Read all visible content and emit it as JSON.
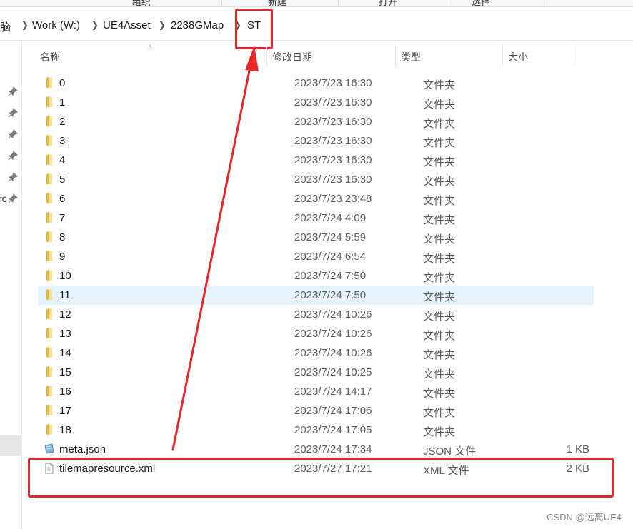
{
  "ribbon": {
    "labels": [
      "组织",
      "新建",
      "打开",
      "选择"
    ]
  },
  "breadcrumb": [
    {
      "label": "电脑"
    },
    {
      "label": "Work (W:)"
    },
    {
      "label": "UE4Asset"
    },
    {
      "label": "2238GMap"
    },
    {
      "label": "ST"
    }
  ],
  "left_pane": {
    "partial_text": "rc"
  },
  "columns": {
    "name": "名称",
    "date": "修改日期",
    "type": "类型",
    "size": "大小"
  },
  "files": [
    {
      "name": "0",
      "date": "2023/7/23 16:30",
      "type": "文件夹",
      "size": "",
      "icon": "folder-icon"
    },
    {
      "name": "1",
      "date": "2023/7/23 16:30",
      "type": "文件夹",
      "size": "",
      "icon": "folder-icon"
    },
    {
      "name": "2",
      "date": "2023/7/23 16:30",
      "type": "文件夹",
      "size": "",
      "icon": "folder-icon"
    },
    {
      "name": "3",
      "date": "2023/7/23 16:30",
      "type": "文件夹",
      "size": "",
      "icon": "folder-icon"
    },
    {
      "name": "4",
      "date": "2023/7/23 16:30",
      "type": "文件夹",
      "size": "",
      "icon": "folder-icon"
    },
    {
      "name": "5",
      "date": "2023/7/23 16:30",
      "type": "文件夹",
      "size": "",
      "icon": "folder-icon"
    },
    {
      "name": "6",
      "date": "2023/7/23 23:48",
      "type": "文件夹",
      "size": "",
      "icon": "folder-icon"
    },
    {
      "name": "7",
      "date": "2023/7/24 4:09",
      "type": "文件夹",
      "size": "",
      "icon": "folder-icon"
    },
    {
      "name": "8",
      "date": "2023/7/24 5:59",
      "type": "文件夹",
      "size": "",
      "icon": "folder-icon"
    },
    {
      "name": "9",
      "date": "2023/7/24 6:54",
      "type": "文件夹",
      "size": "",
      "icon": "folder-icon"
    },
    {
      "name": "10",
      "date": "2023/7/24 7:50",
      "type": "文件夹",
      "size": "",
      "icon": "folder-icon"
    },
    {
      "name": "11",
      "date": "2023/7/24 7:50",
      "type": "文件夹",
      "size": "",
      "icon": "folder-icon"
    },
    {
      "name": "12",
      "date": "2023/7/24 10:26",
      "type": "文件夹",
      "size": "",
      "icon": "folder-icon"
    },
    {
      "name": "13",
      "date": "2023/7/24 10:26",
      "type": "文件夹",
      "size": "",
      "icon": "folder-icon"
    },
    {
      "name": "14",
      "date": "2023/7/24 10:26",
      "type": "文件夹",
      "size": "",
      "icon": "folder-icon"
    },
    {
      "name": "15",
      "date": "2023/7/24 10:25",
      "type": "文件夹",
      "size": "",
      "icon": "folder-icon"
    },
    {
      "name": "16",
      "date": "2023/7/24 14:17",
      "type": "文件夹",
      "size": "",
      "icon": "folder-icon"
    },
    {
      "name": "17",
      "date": "2023/7/24 17:06",
      "type": "文件夹",
      "size": "",
      "icon": "folder-icon"
    },
    {
      "name": "18",
      "date": "2023/7/24 17:05",
      "type": "文件夹",
      "size": "",
      "icon": "folder-icon"
    },
    {
      "name": "meta.json",
      "date": "2023/7/24 17:34",
      "type": "JSON 文件",
      "size": "1 KB",
      "icon": "json-file-icon"
    },
    {
      "name": "tilemapresource.xml",
      "date": "2023/7/27 17:21",
      "type": "XML 文件",
      "size": "2 KB",
      "icon": "xml-file-icon"
    }
  ],
  "hover_row_name": "11",
  "annotation_color": "#e8262a",
  "watermark": "CSDN @远离UE4"
}
